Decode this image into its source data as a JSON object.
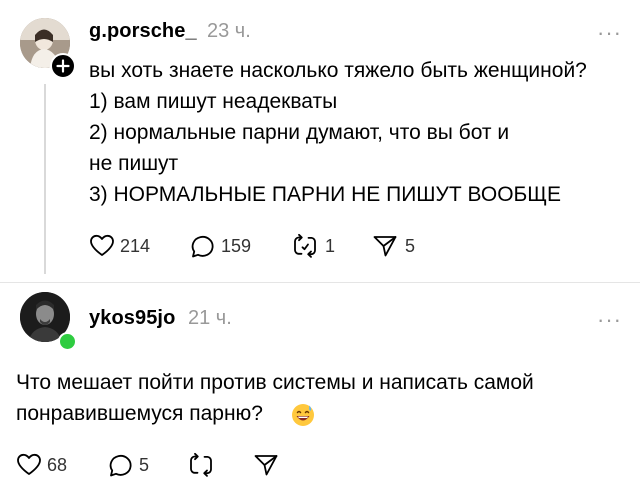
{
  "post1": {
    "username": "g.porsche_",
    "time": "23 ч.",
    "more": "···",
    "lines": [
      "вы хоть знаете насколько тяжело быть женщиной?",
      "1) вам пишут неадекваты",
      "2) нормальные парни думают, что вы бот и",
      "не пишут",
      "3) НОРМАЛЬНЫЕ ПАРНИ НЕ ПИШУТ ВООБЩЕ"
    ],
    "likes": "214",
    "comments": "159",
    "reposts": "1",
    "shares": "5",
    "follow_icon": "plus-icon"
  },
  "post2": {
    "username": "ykos95jo",
    "time": "21 ч.",
    "more": "···",
    "lines": [
      "Что мешает пойти против системы и написать самой",
      "понравившемуся парню?"
    ],
    "emoji": "grinning-sweat-emoji",
    "likes": "68",
    "comments": "5",
    "online_color": "#2ecc40"
  },
  "icons": [
    "heart-icon",
    "comment-icon",
    "repost-icon",
    "share-icon",
    "more-icon"
  ]
}
